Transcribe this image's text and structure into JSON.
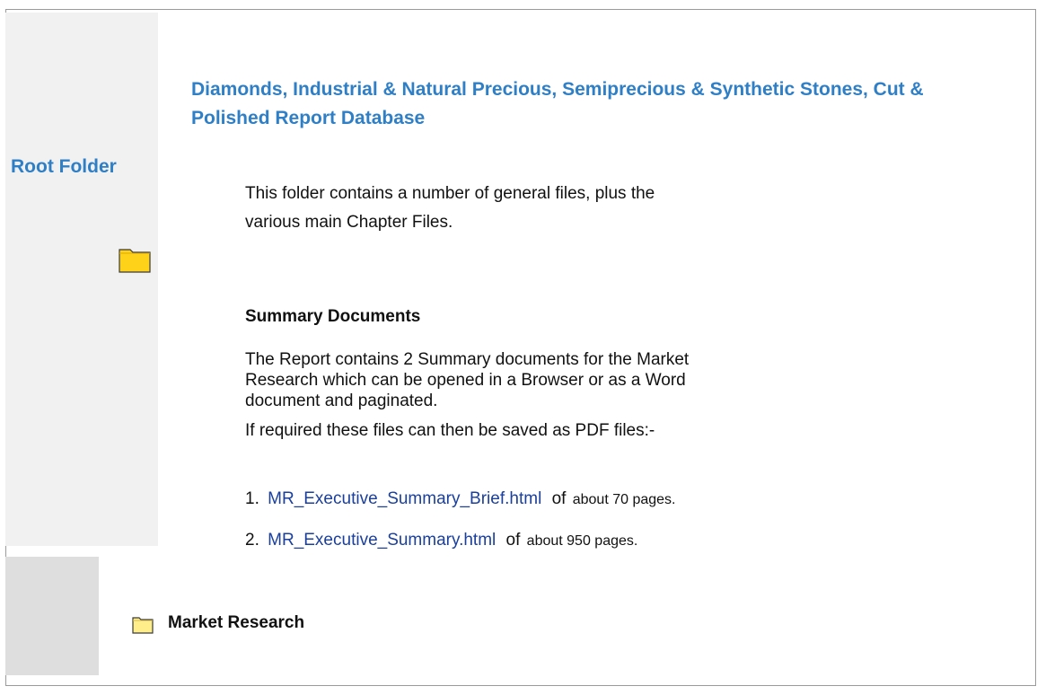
{
  "sidebar": {
    "root_folder_label": "Root Folder",
    "root_folder_icon": "folder-icon"
  },
  "main": {
    "title": "Diamonds, Industrial & Natural Precious, Semiprecious & Synthetic Stones, Cut & Polished Report Database",
    "intro": "This folder contains a number of general files, plus the various main Chapter Files.",
    "summary_heading": "Summary Documents",
    "summary_description": "The Report contains 2 Summary documents for the Market Research which can be opened in a Browser or as a Word document and paginated.",
    "pdf_text": "If required these files can then be saved as PDF files:-",
    "files": [
      {
        "number": "1.",
        "name": "MR_Executive_Summary_Brief.html",
        "of": "of",
        "pages": "about 70 pages."
      },
      {
        "number": "2.",
        "name": "MR_Executive_Summary.html",
        "of": "of",
        "pages": "about 950 pages."
      }
    ]
  },
  "market_research": {
    "label": "Market Research",
    "icon": "folder-icon"
  },
  "colors": {
    "heading_blue": "#2f7fc7",
    "link_blue": "#1a3f9c",
    "folder_yellow": "#ffd21a",
    "sidebar_gray": "#f1f1f1",
    "bottom_panel_gray": "#dedede"
  }
}
